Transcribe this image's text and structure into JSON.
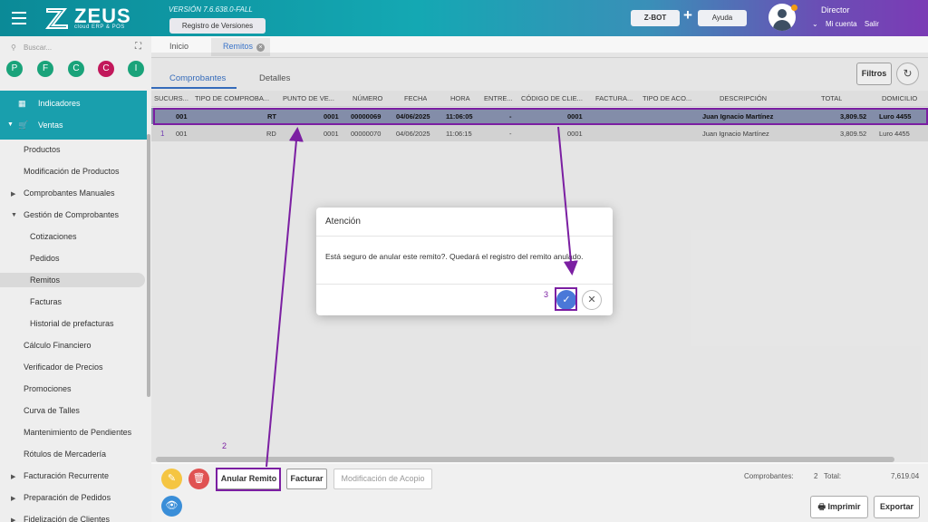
{
  "header": {
    "brand": "ZEUS",
    "brand_sub": "cloud ERP & POS",
    "version": "VERSIÓN 7.6.638.0-FALL",
    "registro_label": "Registro de Versiones",
    "zbot_label": "Z-BOT",
    "plus": "+",
    "ayuda_label": "Ayuda",
    "user_name": "Director",
    "mi_cuenta": "Mi cuenta",
    "salir": "Salir"
  },
  "sidebar": {
    "search_placeholder": "Buscar...",
    "circles": [
      {
        "letter": "P",
        "color": "#1aa37a"
      },
      {
        "letter": "F",
        "color": "#1aa37a"
      },
      {
        "letter": "C",
        "color": "#1aa37a"
      },
      {
        "letter": "C",
        "color": "#c2185b"
      },
      {
        "letter": "I",
        "color": "#1aa37a"
      }
    ],
    "indicadores": "Indicadores",
    "ventas": "Ventas",
    "items": [
      "Productos",
      "Modificación de Productos",
      "Comprobantes Manuales",
      "Gestión de Comprobantes",
      "Cotizaciones",
      "Pedidos",
      "Remitos",
      "Facturas",
      "Historial de prefacturas",
      "Cálculo Financiero",
      "Verificador de Precios",
      "Promociones",
      "Curva de Talles",
      "Mantenimiento de Pendientes",
      "Rótulos de Mercadería",
      "Facturación Recurrente",
      "Preparación de Pedidos",
      "Fidelización de Clientes"
    ]
  },
  "tabs": {
    "inicio": "Inicio",
    "remitos": "Remitos",
    "close": "×"
  },
  "subtabs": {
    "comprobantes": "Comprobantes",
    "detalles": "Detalles"
  },
  "toolbar": {
    "filtros": "Filtros",
    "refresh": "↻"
  },
  "grid": {
    "headers": [
      "SUCURS...",
      "TIPO DE COMPROBA...",
      "PUNTO DE VE...",
      "NÚMERO",
      "FECHA",
      "HORA",
      "ENTRE...",
      "CÓDIGO DE CLIE...",
      "FACTURA...",
      "TIPO DE ACO...",
      "DESCRIPCIÓN",
      "TOTAL",
      "DOMICILIO"
    ],
    "rows": [
      {
        "sucursal": "001",
        "tipo": "RT",
        "punto": "0001",
        "numero": "00000069",
        "fecha": "04/06/2025",
        "hora": "11:06:05",
        "entrega": "-",
        "codigo": "0001",
        "descripcion": "Juan Ignacio Martínez",
        "total": "3,809.52",
        "domicilio": "Luro 4455"
      },
      {
        "sucursal": "001",
        "tipo": "RD",
        "punto": "0001",
        "numero": "00000070",
        "fecha": "04/06/2025",
        "hora": "11:06:15",
        "entrega": "-",
        "codigo": "0001",
        "descripcion": "Juan Ignacio Martínez",
        "total": "3,809.52",
        "domicilio": "Luro 4455"
      }
    ]
  },
  "bottom": {
    "edit_icon": "✎",
    "delete_icon": "🗑",
    "view_icon": "👁",
    "anular": "Anular Remito",
    "facturar": "Facturar",
    "modificacion": "Modificación de Acopio",
    "comprobantes_label": "Comprobantes:",
    "comprobantes_count": "2",
    "total_label": "Total:",
    "total_value": "7,619.04",
    "imprimir": "Imprimir",
    "exportar": "Exportar"
  },
  "modal": {
    "title": "Atención",
    "message": "Está seguro de anular este remito?. Quedará el registro del remito anulado.",
    "ok_icon": "✓",
    "cancel_icon": "✕"
  },
  "annotations": {
    "n1": "1",
    "n2": "2",
    "n3": "3",
    "color": "#7b1fa2"
  }
}
